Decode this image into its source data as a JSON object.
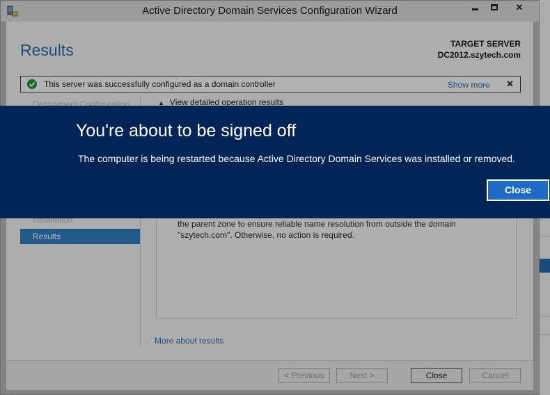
{
  "window": {
    "title": "Active Directory Domain Services Configuration Wizard",
    "close_glyph": "✕"
  },
  "header": {
    "page_title": "Results",
    "target_label": "TARGET SERVER",
    "target_server": "DC2012.szytech.com"
  },
  "notification": {
    "message": "This server was successfully configured as a domain controller",
    "show_more": "Show more",
    "dismiss_glyph": "✕"
  },
  "nav": {
    "items": [
      {
        "label": "Deployment Configuration"
      },
      {
        "label": "Installation"
      },
      {
        "label": "Results"
      }
    ]
  },
  "details": {
    "toggle_label": "View detailed operation results",
    "text": "the parent zone to ensure reliable name resolution from outside the domain \"szytech.com\". Otherwise, no action is required.",
    "more_link": "More about results"
  },
  "footer": {
    "previous": "< Previous",
    "next": "Next >",
    "close": "Close",
    "cancel": "Cancel"
  },
  "signoff": {
    "title": "You're about to be signed off",
    "message": "The computer is being restarted because Active Directory Domain Services was installed or removed.",
    "close": "Close"
  },
  "colors": {
    "banner": "#012456",
    "accent": "#2c7dbe",
    "success": "#1e9a3a"
  }
}
